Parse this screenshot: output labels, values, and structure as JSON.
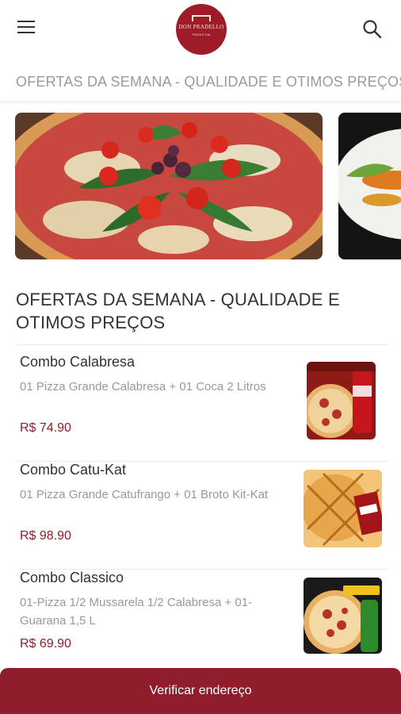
{
  "header": {
    "menu_icon": "hamburger-menu-icon",
    "logo_brand": "DON PRADELLO",
    "logo_tag": "PIZZA E CIA",
    "search_icon": "search-icon"
  },
  "marquee": {
    "text": "OFERTAS DA SEMANA - QUALIDADE E OTIMOS PREÇOS"
  },
  "section": {
    "title": "OFERTAS DA SEMANA - QUALIDADE E OTIMOS PREÇOS"
  },
  "products": [
    {
      "name": "Combo Calabresa",
      "description": "01 Pizza Grande Calabresa + 01 Coca 2 Litros",
      "price": "R$ 74.90"
    },
    {
      "name": "Combo Catu-Kat",
      "description": "01 Pizza Grande Catufrango + 01 Broto Kit-Kat",
      "price": "R$ 98.90"
    },
    {
      "name": "Combo Classico",
      "description": "01-Pizza 1/2 Mussarela 1/2 Calabresa + 01-Guarana 1,5 L",
      "price": "R$ 69.90"
    }
  ],
  "cta": {
    "label": "Verificar endereço"
  },
  "colors": {
    "brand": "#8f1d2c",
    "muted_text": "#999999"
  }
}
